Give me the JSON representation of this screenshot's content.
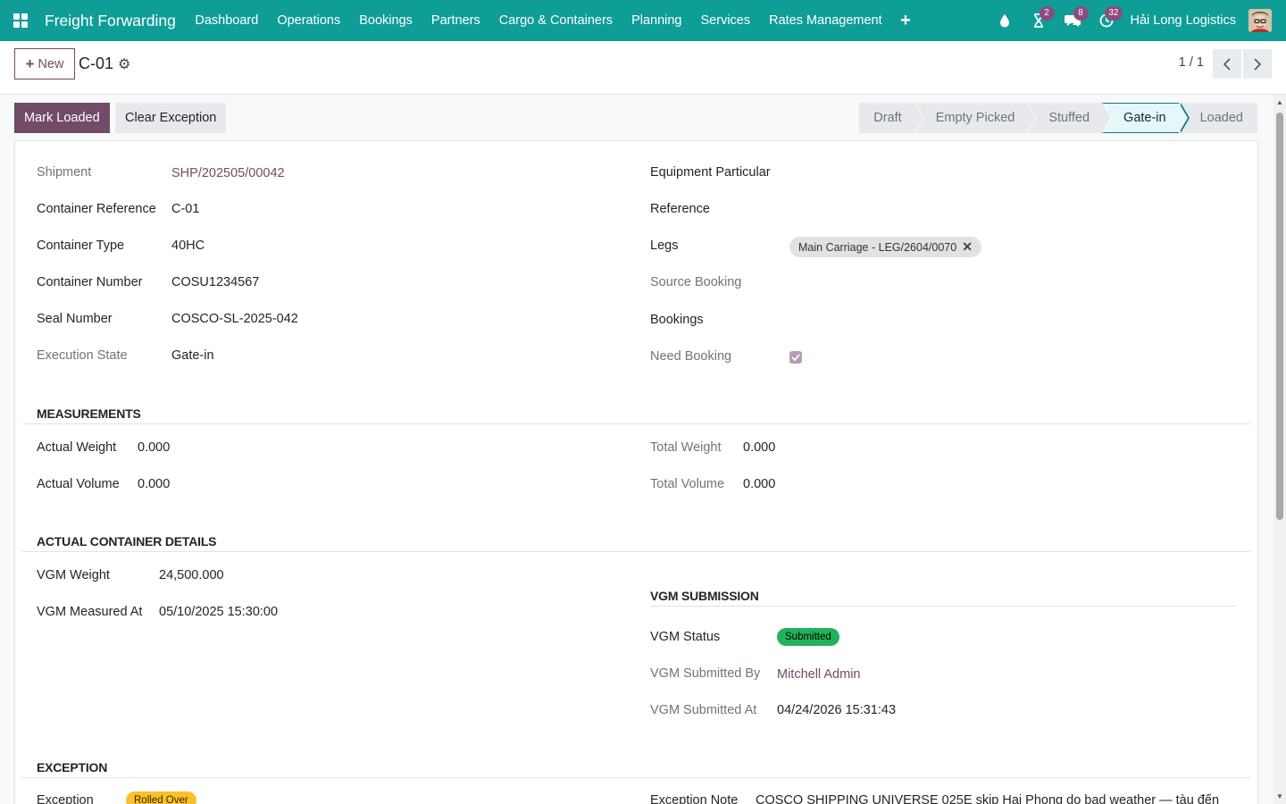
{
  "app": {
    "title": "Freight Forwarding",
    "menu": [
      "Dashboard",
      "Operations",
      "Bookings",
      "Partners",
      "Cargo & Containers",
      "Planning",
      "Services",
      "Rates Management"
    ],
    "company": "Hải Long Logistics",
    "badges": {
      "activity": "2",
      "messages": "8",
      "updates": "32"
    },
    "accent": "#0f9d97",
    "primary": "#714b67"
  },
  "control": {
    "new_label": "New",
    "record_title": "C-01",
    "pager": "1 / 1"
  },
  "actions": {
    "mark_loaded": "Mark Loaded",
    "clear_exception": "Clear Exception"
  },
  "stages": [
    "Draft",
    "Empty Picked",
    "Stuffed",
    "Gate-in",
    "Loaded"
  ],
  "active_stage": "Gate-in",
  "left_fields": {
    "shipment_label": "Shipment",
    "shipment_value": "SHP/202505/00042",
    "container_ref_label": "Container Reference",
    "container_ref_value": "C-01",
    "container_type_label": "Container Type",
    "container_type_value": "40HC",
    "container_number_label": "Container Number",
    "container_number_value": "COSU1234567",
    "seal_number_label": "Seal Number",
    "seal_number_value": "COSCO-SL-2025-042",
    "execution_state_label": "Execution State",
    "execution_state_value": "Gate-in"
  },
  "right_fields": {
    "equipment_label": "Equipment Particular",
    "reference_label": "Reference",
    "legs_label": "Legs",
    "legs_tag": "Main Carriage - LEG/2604/0070",
    "source_booking_label": "Source Booking",
    "bookings_label": "Bookings",
    "need_booking_label": "Need Booking",
    "need_booking_checked": true
  },
  "measurements": {
    "title": "MEASUREMENTS",
    "actual_weight_label": "Actual Weight",
    "actual_weight_value": "0.000",
    "actual_volume_label": "Actual Volume",
    "actual_volume_value": "0.000",
    "total_weight_label": "Total Weight",
    "total_weight_value": "0.000",
    "total_volume_label": "Total Volume",
    "total_volume_value": "0.000"
  },
  "actual_details": {
    "title": "ACTUAL CONTAINER DETAILS",
    "vgm_weight_label": "VGM Weight",
    "vgm_weight_value": "24,500.000",
    "vgm_measured_label": "VGM Measured At",
    "vgm_measured_value": "05/10/2025 15:30:00"
  },
  "vgm_submission": {
    "title": "VGM SUBMISSION",
    "status_label": "VGM Status",
    "status_value": "Submitted",
    "submitted_by_label": "VGM Submitted By",
    "submitted_by_value": "Mitchell Admin",
    "submitted_at_label": "VGM Submitted At",
    "submitted_at_value": "04/24/2026 15:31:43"
  },
  "exception": {
    "title": "EXCEPTION",
    "exception_label": "Exception",
    "exception_value": "Rolled Over",
    "note_label": "Exception Note",
    "note_value": "COSCO SHIPPING UNIVERSE 025E skip Hai Phong do bad weather — tàu đến"
  }
}
